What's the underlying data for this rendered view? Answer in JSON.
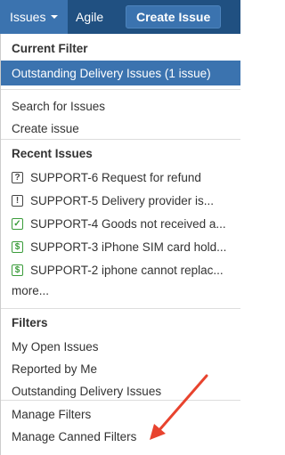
{
  "nav": {
    "issues_label": "Issues",
    "agile_label": "Agile",
    "create_label": "Create Issue"
  },
  "current_filter": {
    "heading": "Current Filter",
    "selected": "Outstanding Delivery Issues (1 issue)"
  },
  "actions": {
    "search": "Search for Issues",
    "create": "Create issue"
  },
  "recent": {
    "heading": "Recent Issues",
    "items": [
      {
        "icon": "question-icon",
        "glyph": "?",
        "text": "SUPPORT-6 Request for refund"
      },
      {
        "icon": "exclamation-icon",
        "glyph": "!",
        "text": "SUPPORT-5 Delivery provider is..."
      },
      {
        "icon": "check-icon",
        "glyph": "✓",
        "text": "SUPPORT-4 Goods not received a..."
      },
      {
        "icon": "dollar-icon",
        "glyph": "$",
        "text": "SUPPORT-3 iPhone SIM card hold..."
      },
      {
        "icon": "dollar-icon",
        "glyph": "$",
        "text": "SUPPORT-2 iphone cannot replac..."
      }
    ],
    "more": "more..."
  },
  "filters": {
    "heading": "Filters",
    "items": [
      "My Open Issues",
      "Reported by Me",
      "Outstanding Delivery Issues"
    ]
  },
  "manage": {
    "manage_filters": "Manage Filters",
    "manage_canned": "Manage Canned Filters"
  },
  "colors": {
    "topbar": "#205081",
    "accent": "#3b73af",
    "arrow": "#e8432e"
  }
}
